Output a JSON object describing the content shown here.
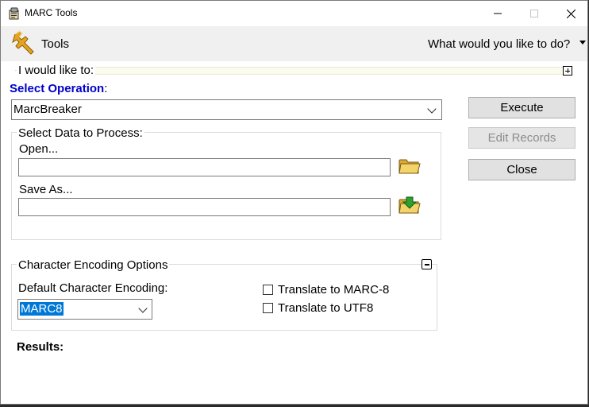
{
  "window": {
    "title": "MARC Tools",
    "icon": "marc-tools-app-icon"
  },
  "toolbar": {
    "tools_label": "Tools",
    "tools_icon": "wrench-icon",
    "tasks_dropdown": "What would you like to do?"
  },
  "main": {
    "would_like_label": "I would like to:",
    "select_operation_label": "Select Operation",
    "select_operation_colon": ":",
    "operation_value": "MarcBreaker",
    "data_group_title": "Select Data to Process:",
    "open_label": "Open...",
    "open_value": "",
    "save_as_label": "Save As...",
    "save_value": "",
    "encoding_group_title": "Character Encoding Options",
    "default_encoding_label": "Default Character Encoding:",
    "default_encoding_value": "MARC8",
    "translate_marc8_label": "Translate to MARC-8",
    "translate_marc8_checked": false,
    "translate_utf8_label": "Translate to UTF8",
    "translate_utf8_checked": false,
    "results_label": "Results:"
  },
  "buttons": {
    "execute": "Execute",
    "edit_records": "Edit Records",
    "close": "Close"
  },
  "colors": {
    "select_operation_label": "#0000cc",
    "selection_highlight": "#0078d7",
    "toolbar_bg": "#f0f0f0",
    "button_bg": "#e1e1e1"
  }
}
